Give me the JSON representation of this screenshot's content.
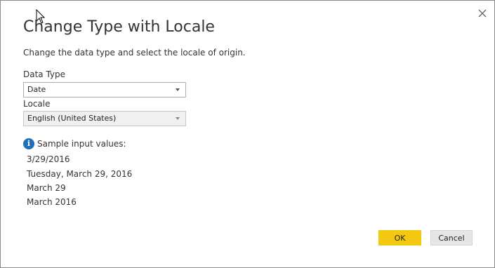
{
  "dialog": {
    "title": "Change Type with Locale",
    "subtitle": "Change the data type and select the locale of origin.",
    "close_icon": "close-icon"
  },
  "data_type": {
    "label": "Data Type",
    "selected": "Date"
  },
  "locale": {
    "label": "Locale",
    "selected": "English (United States)"
  },
  "samples": {
    "heading": "Sample input values:",
    "icon": "info-icon",
    "values": [
      "3/29/2016",
      "Tuesday, March 29, 2016",
      "March 29",
      "March 2016"
    ]
  },
  "buttons": {
    "ok_label": "OK",
    "cancel_label": "Cancel"
  },
  "colors": {
    "ok_accent": "#f2c811",
    "info_blue": "#1f6fba"
  }
}
